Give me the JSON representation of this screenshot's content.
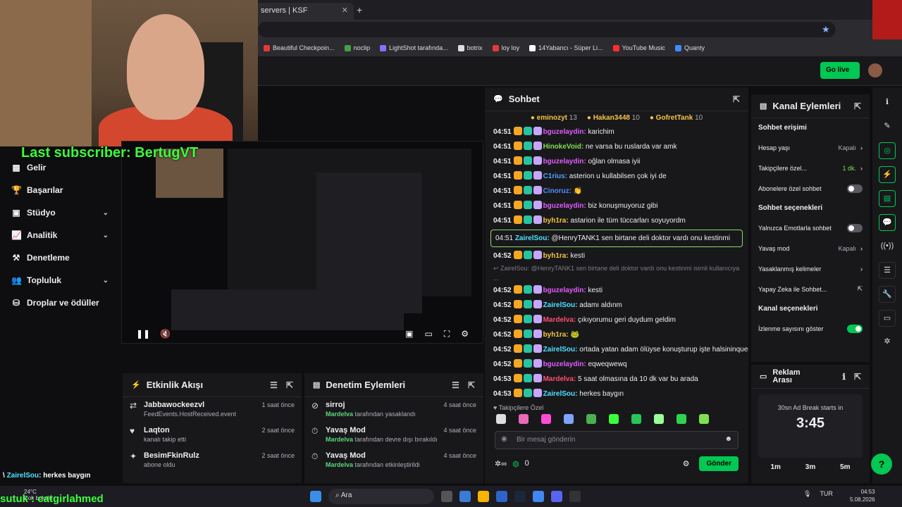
{
  "browser": {
    "tab_title": "servers | KSF",
    "bookmarks": [
      "Beautiful Checkpoin...",
      "noclip",
      "LightShot tarafında...",
      "botrix",
      "loy loy",
      "14Yabancı - Süper Li...",
      "YouTube Music",
      "Quanty"
    ],
    "bookmark_colors": [
      "#e53935",
      "#43a047",
      "#8e6cff",
      "#dddddd",
      "#e53935",
      "#ffffff",
      "#ff2d2d",
      "#3f8cff"
    ]
  },
  "header": {
    "golive_label": "Go live"
  },
  "overlay": {
    "last_subscriber": "Last subscriber: BertugVT",
    "chat_user": "ZairelSou",
    "chat_text": ": herkes baygın",
    "bottom_text": "sutuk : catgirlahmed",
    "weather_temp": "24°C",
    "weather_desc": "Çok bulutlu"
  },
  "nav": {
    "items": [
      {
        "label": "Gelir",
        "icon": "revenue-icon",
        "glyph": "▦",
        "chev": false
      },
      {
        "label": "Başarılar",
        "icon": "trophy-icon",
        "glyph": "🏆",
        "chev": false
      },
      {
        "label": "Stüdyo",
        "icon": "studio-icon",
        "glyph": "▣",
        "chev": true
      },
      {
        "label": "Analitik",
        "icon": "analytics-icon",
        "glyph": "📈",
        "chev": true
      },
      {
        "label": "Denetleme",
        "icon": "moderation-icon",
        "glyph": "⚒",
        "chev": false
      },
      {
        "label": "Topluluk",
        "icon": "community-icon",
        "glyph": "👥",
        "chev": true
      },
      {
        "label": "Droplar ve ödüller",
        "icon": "drops-icon",
        "glyph": "⛁",
        "chev": false
      }
    ]
  },
  "activity": {
    "title": "Etkinlik Akışı",
    "items": [
      {
        "name": "Jabbawockeezvl",
        "desc": "FeedEvents.HostReceived.event",
        "time": "1 saat önce",
        "icon": "host-icon",
        "glyph": "⇄"
      },
      {
        "name": "Laqton",
        "desc": "kanalı takip etti",
        "time": "2 saat önce",
        "icon": "heart-icon",
        "glyph": "♥"
      },
      {
        "name": "BesimFkinRulz",
        "desc": "abone oldu",
        "time": "2 saat önce",
        "icon": "star-icon",
        "glyph": "✦"
      }
    ]
  },
  "modlog": {
    "title": "Denetim Eylemleri",
    "items": [
      {
        "name": "sirroj",
        "by": "Mardelva",
        "desc": " tarafından yasaklandı",
        "time": "4 saat önce",
        "icon": "ban-icon",
        "glyph": "⊘"
      },
      {
        "name": "Yavaş Mod",
        "by": "Mardelva",
        "desc": " tarafından devre dışı bırakıldı",
        "time": "4 saat önce",
        "icon": "slow-icon",
        "glyph": "⏱"
      },
      {
        "name": "Yavaş Mod",
        "by": "Mardelva",
        "desc": " tarafından etkinleştirildi",
        "time": "4 saat önce",
        "icon": "slow-icon",
        "glyph": "⏱"
      }
    ]
  },
  "chat": {
    "title": "Sohbet",
    "top": [
      {
        "name": "eminozyt",
        "count": "13"
      },
      {
        "name": "Hakan3448",
        "count": "10"
      },
      {
        "name": "GofretTank",
        "count": "10"
      }
    ],
    "messages": [
      {
        "time": "04:51",
        "user": "bguzelaydin",
        "color": "#e25cff",
        "text": " karichim"
      },
      {
        "time": "04:51",
        "user": "HinokeVoid",
        "color": "#7fe04f",
        "text": " ne varsa bu ruslarda var amk"
      },
      {
        "time": "04:51",
        "user": "bguzelaydin",
        "color": "#e25cff",
        "text": " oğlan olmasa iyii"
      },
      {
        "time": "04:51",
        "user": "C1rius",
        "color": "#4da3ff",
        "text": " asterion u kullabilsen çok iyi de"
      },
      {
        "time": "04:51",
        "user": "Cinoruz",
        "color": "#4d8dff",
        "text": " 👏"
      },
      {
        "time": "04:51",
        "user": "bguzelaydin",
        "color": "#e25cff",
        "text": " biz konuşmuyoruz gibi"
      },
      {
        "time": "04:51",
        "user": "byh1ra",
        "color": "#f5c542",
        "text": " astarion ile tüm tüccarları soyuyordm"
      }
    ],
    "highlight": {
      "time": "04:51",
      "user": "ZairelSou",
      "color": "#4de3ff",
      "text": " @HenryTANK1 sen birtane deli doktor vardı onu kestinmi"
    },
    "messages2": [
      {
        "time": "04:52",
        "user": "byh1ra",
        "color": "#f5c542",
        "text": " kesti"
      }
    ],
    "reply": "↩ ZairelSou: @HenryTANK1 sen birtane deli doktor vardı onu kestinmi isimli kullanıcıya ...",
    "messages3": [
      {
        "time": "04:52",
        "user": "bguzelaydin",
        "color": "#e25cff",
        "text": " kesti"
      },
      {
        "time": "04:52",
        "user": "ZairelSou",
        "color": "#4de3ff",
        "text": " adamı aldınm"
      },
      {
        "time": "04:52",
        "user": "Mardelva",
        "color": "#ff4d6d",
        "text": " çıkıyorumu geri duydum geldim"
      },
      {
        "time": "04:52",
        "user": "byh1ra",
        "color": "#f5c542",
        "text": " 🐸"
      },
      {
        "time": "04:52",
        "user": "ZairelSou",
        "color": "#4de3ff",
        "text": " ortada yatan adam ölüyse konuşturup işte halsininquesti başlatıyon"
      },
      {
        "time": "04:52",
        "user": "bguzelaydin",
        "color": "#e25cff",
        "text": " eqweqwewq"
      },
      {
        "time": "04:53",
        "user": "Mardelva",
        "color": "#ff4d6d",
        "text": " 5 saat olmasına da 10 dk var bu arada"
      },
      {
        "time": "04:53",
        "user": "ZairelSou",
        "color": "#4de3ff",
        "text": " herkes baygın"
      }
    ],
    "followers_label": "♥ Takipçilere Özel",
    "input_placeholder": "Bir mesaj gönderin",
    "points": "0",
    "send_label": "Gönder"
  },
  "actions": {
    "title": "Kanal Eylemleri",
    "sec1": "Sohbet erişimi",
    "rows1": [
      {
        "label": "Hesap yaşı",
        "value": "Kapalı"
      },
      {
        "label": "Takipçilere özel...",
        "value": "1 dk."
      },
      {
        "label": "Abonelere özel sohbet",
        "value": ""
      }
    ],
    "sec2": "Sohbet seçenekleri",
    "rows2": [
      {
        "label": "Yalnızca Emotlarla sohbet",
        "value": ""
      },
      {
        "label": "Yavaş mod",
        "value": "Kapalı"
      },
      {
        "label": "Yasaklanmış kelimeler",
        "value": ""
      },
      {
        "label": "Yapay Zeka ile Sohbet...",
        "value": ""
      }
    ],
    "sec3": "Kanal seçenekleri",
    "rows3": [
      {
        "label": "İzlenme sayısını göster",
        "value": ""
      }
    ]
  },
  "ad": {
    "title": "Reklam Arası",
    "subtitle": "30sn Ad Break starts in",
    "countdown": "3:45",
    "buttons": [
      "1m",
      "3m",
      "5m"
    ]
  },
  "taskbar": {
    "search": "Ara",
    "lang": "TUR",
    "time": "04:53",
    "date": "5.08.2026"
  }
}
